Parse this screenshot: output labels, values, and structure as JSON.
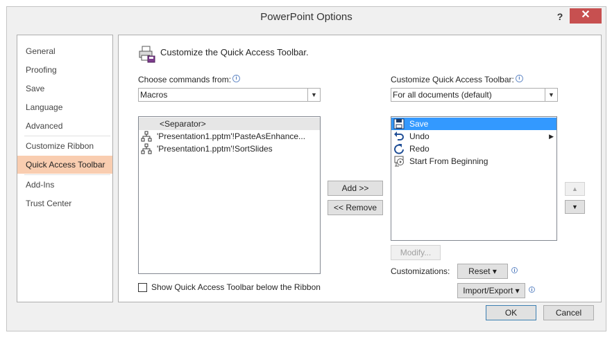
{
  "window": {
    "title": "PowerPoint Options",
    "help": "?",
    "close": "✕"
  },
  "sidebar": {
    "items": [
      {
        "label": "General"
      },
      {
        "label": "Proofing"
      },
      {
        "label": "Save"
      },
      {
        "label": "Language"
      },
      {
        "label": "Advanced"
      },
      {
        "label": "Customize Ribbon"
      },
      {
        "label": "Quick Access Toolbar",
        "selected": true
      },
      {
        "label": "Add-Ins"
      },
      {
        "label": "Trust Center"
      }
    ]
  },
  "main": {
    "heading": "Customize the Quick Access Toolbar.",
    "choose_label": "Choose commands from:",
    "choose_value": "Macros",
    "customize_label": "Customize Quick Access Toolbar:",
    "customize_value": "For all documents (default)",
    "commands": [
      {
        "label": "<Separator>"
      },
      {
        "label": "'Presentation1.pptm'!PasteAsEnhance..."
      },
      {
        "label": "'Presentation1.pptm'!SortSlides"
      }
    ],
    "toolbar_items": [
      {
        "label": "Save",
        "icon": "save-icon",
        "selected": true
      },
      {
        "label": "Undo",
        "icon": "undo-icon"
      },
      {
        "label": "Redo",
        "icon": "redo-icon"
      },
      {
        "label": "Start From Beginning",
        "icon": "slideshow-icon"
      }
    ],
    "add_label": "Add >>",
    "remove_label": "<< Remove",
    "modify_label": "Modify...",
    "customizations_label": "Customizations:",
    "reset_label": "Reset ▾",
    "import_export_label": "Import/Export ▾",
    "show_below_label": "Show Quick Access Toolbar below the Ribbon",
    "show_below_checked": false,
    "move_up": "▲",
    "move_down": "▼"
  },
  "footer": {
    "ok_label": "OK",
    "cancel_label": "Cancel"
  },
  "colors": {
    "selection": "#3399ff",
    "nav_selected": "#f9cdb0",
    "close": "#c75050"
  }
}
